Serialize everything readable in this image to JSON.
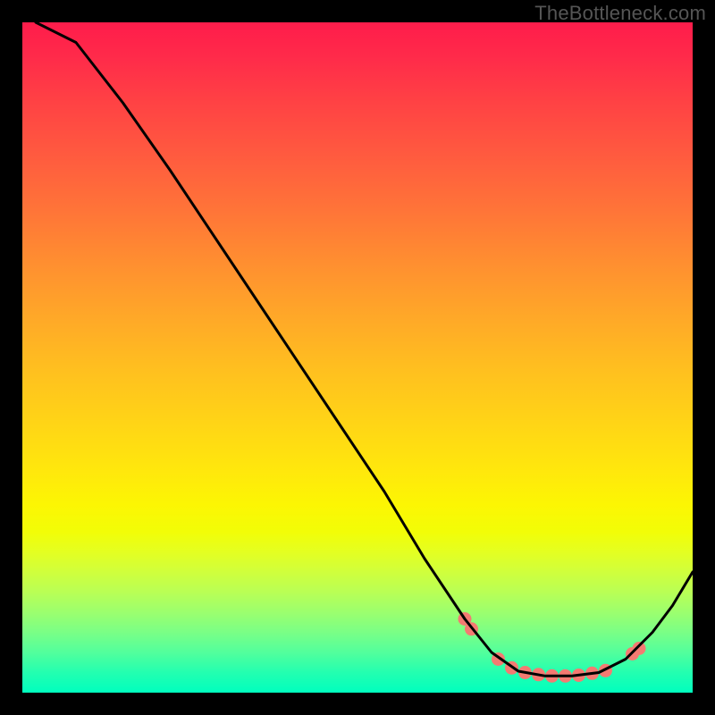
{
  "watermark": "TheBottleneck.com",
  "chart_data": {
    "type": "line",
    "title": "",
    "xlabel": "",
    "ylabel": "",
    "xlim": [
      0,
      100
    ],
    "ylim": [
      0,
      100
    ],
    "background": "vertical-gradient red→yellow→green",
    "curve": [
      {
        "x": 2,
        "y": 100
      },
      {
        "x": 8,
        "y": 97
      },
      {
        "x": 15,
        "y": 88
      },
      {
        "x": 22,
        "y": 78
      },
      {
        "x": 30,
        "y": 66
      },
      {
        "x": 38,
        "y": 54
      },
      {
        "x": 46,
        "y": 42
      },
      {
        "x": 54,
        "y": 30
      },
      {
        "x": 60,
        "y": 20
      },
      {
        "x": 66,
        "y": 11
      },
      {
        "x": 70,
        "y": 6
      },
      {
        "x": 74,
        "y": 3.2
      },
      {
        "x": 78,
        "y": 2.5
      },
      {
        "x": 82,
        "y": 2.5
      },
      {
        "x": 86,
        "y": 3
      },
      {
        "x": 90,
        "y": 5
      },
      {
        "x": 94,
        "y": 9
      },
      {
        "x": 97,
        "y": 13
      },
      {
        "x": 100,
        "y": 18
      }
    ],
    "markers": [
      {
        "x": 66,
        "y": 11
      },
      {
        "x": 67,
        "y": 9.5
      },
      {
        "x": 71,
        "y": 5
      },
      {
        "x": 73,
        "y": 3.7
      },
      {
        "x": 75,
        "y": 3
      },
      {
        "x": 77,
        "y": 2.7
      },
      {
        "x": 79,
        "y": 2.5
      },
      {
        "x": 81,
        "y": 2.5
      },
      {
        "x": 83,
        "y": 2.6
      },
      {
        "x": 85,
        "y": 2.9
      },
      {
        "x": 87,
        "y": 3.3
      },
      {
        "x": 91,
        "y": 5.8
      },
      {
        "x": 92,
        "y": 6.6
      }
    ],
    "marker_style": {
      "fill": "#f47a72",
      "stroke": "#f47a72",
      "radius": 7
    },
    "curve_style": {
      "stroke": "#000000",
      "width": 3
    }
  }
}
